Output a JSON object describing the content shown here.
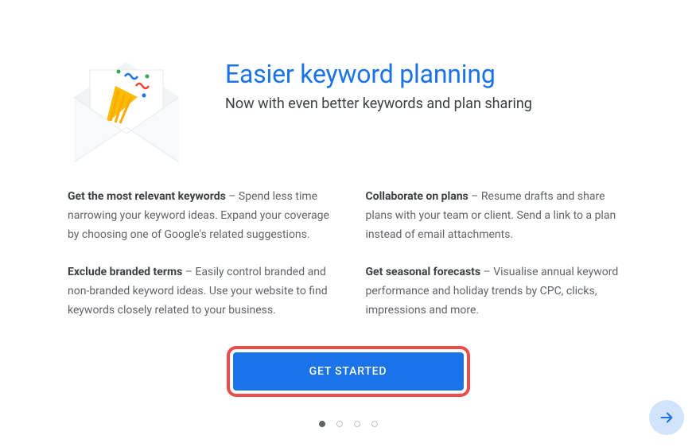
{
  "header": {
    "title": "Easier keyword planning",
    "subtitle": "Now with even better keywords and plan sharing"
  },
  "features": {
    "left": [
      {
        "title": "Get the most relevant keywords",
        "body": " – Spend less time narrowing your keyword ideas. Expand your coverage by choosing one of Google's related suggestions."
      },
      {
        "title": "Exclude branded terms",
        "body": " – Easily control branded and non-branded keyword ideas. Use your website to find keywords closely related to your business."
      }
    ],
    "right": [
      {
        "title": "Collaborate on plans",
        "body": " – Resume drafts and share plans with your team or client. Send a link to a plan instead of email attachments."
      },
      {
        "title": "Get seasonal forecasts",
        "body": " – Visualise annual keyword performance and holiday trends by CPC, clicks, impressions and more."
      }
    ]
  },
  "cta": {
    "label": "GET STARTED"
  },
  "pagination": {
    "total": 4,
    "active": 0
  },
  "icons": {
    "envelope": "envelope-confetti-icon",
    "arrow": "arrow-right-icon"
  }
}
